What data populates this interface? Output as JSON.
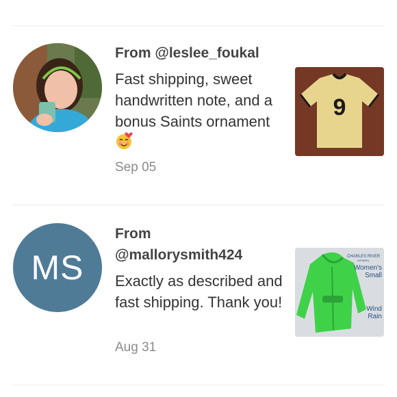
{
  "reviews": [
    {
      "from_prefix": "From ",
      "username": "@leslee_foukal",
      "text": "Fast shipping, sweet handwritten note, and a bonus Saints ornament",
      "emoji": "smiling-face-with-hearts-icon",
      "date": "Sep 05",
      "product": "jersey-photo"
    },
    {
      "from_prefix": "From",
      "username": "@mallorysmith424",
      "initials": "MS",
      "text": "Exactly as described and fast shipping. Thank you!",
      "date": "Aug 31",
      "product": "jacket-photo",
      "product_brand": "CHARLES RIVER",
      "product_brand_sub": "APPAREL",
      "product_tag_1": "Women's",
      "product_tag_2": "Small",
      "product_tag_3": "Wind",
      "product_tag_4": "Rain"
    }
  ],
  "colors": {
    "avatar_bg": "#4f7b97",
    "jacket_green": "#3fd248",
    "jersey_gold": "#e7d58e"
  }
}
